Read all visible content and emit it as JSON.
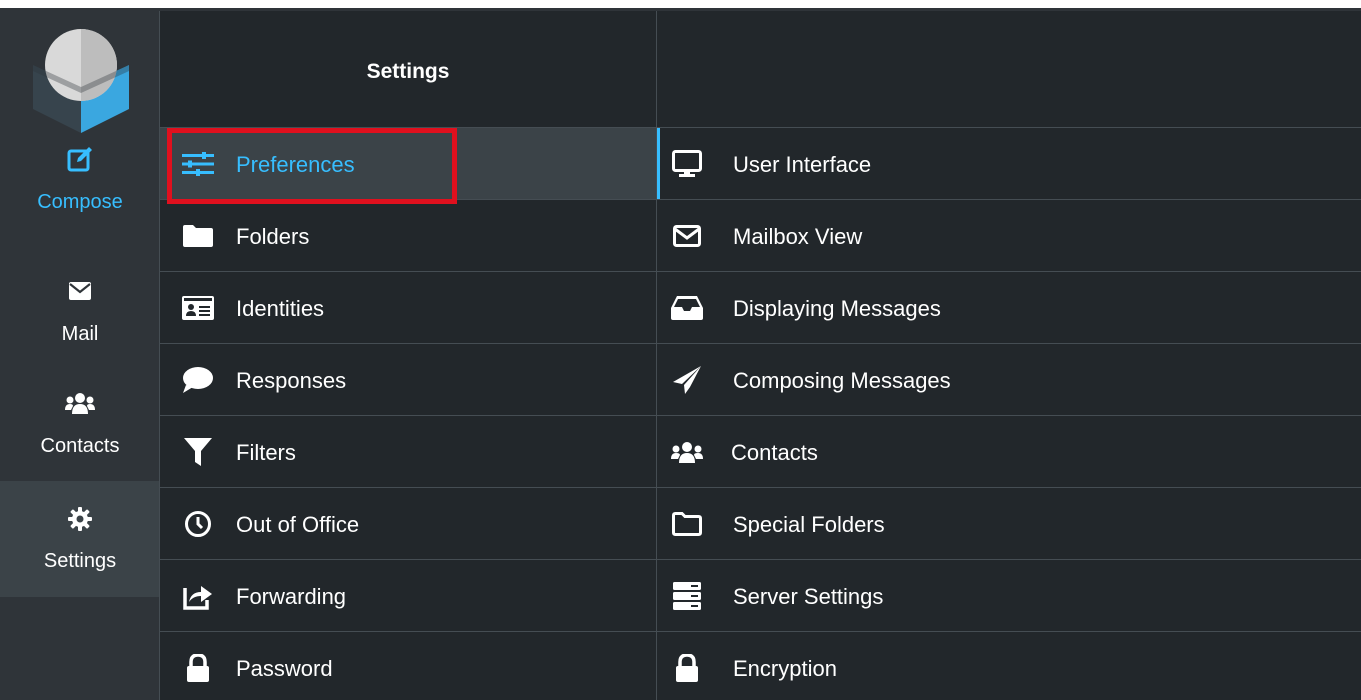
{
  "colors": {
    "accent": "#37beff",
    "background": "#22272b",
    "taskbar": "#2f3439",
    "selected_row": "#3b4348",
    "highlight_border": "#e0101e",
    "divider": "#454d53"
  },
  "taskbar": {
    "items": [
      {
        "label": "Compose",
        "icon": "compose-icon"
      },
      {
        "label": "Mail",
        "icon": "envelope-icon"
      },
      {
        "label": "Contacts",
        "icon": "users-icon"
      },
      {
        "label": "Settings",
        "icon": "gear-icon",
        "active": true
      }
    ]
  },
  "settings": {
    "title": "Settings",
    "items": [
      {
        "label": "Preferences",
        "icon": "sliders-icon",
        "selected": true
      },
      {
        "label": "Folders",
        "icon": "folder-icon"
      },
      {
        "label": "Identities",
        "icon": "id-card-icon"
      },
      {
        "label": "Responses",
        "icon": "comment-icon"
      },
      {
        "label": "Filters",
        "icon": "filter-icon"
      },
      {
        "label": "Out of Office",
        "icon": "clock-icon"
      },
      {
        "label": "Forwarding",
        "icon": "share-icon"
      },
      {
        "label": "Password",
        "icon": "lock-icon"
      }
    ]
  },
  "preferences": {
    "items": [
      {
        "label": "User Interface",
        "icon": "desktop-icon",
        "selected": true
      },
      {
        "label": "Mailbox View",
        "icon": "envelope-outline-icon"
      },
      {
        "label": "Displaying Messages",
        "icon": "inbox-icon"
      },
      {
        "label": "Composing Messages",
        "icon": "paper-plane-icon"
      },
      {
        "label": "Contacts",
        "icon": "users-icon"
      },
      {
        "label": "Special Folders",
        "icon": "folder-outline-icon"
      },
      {
        "label": "Server Settings",
        "icon": "server-icon"
      },
      {
        "label": "Encryption",
        "icon": "lock-icon"
      }
    ]
  }
}
